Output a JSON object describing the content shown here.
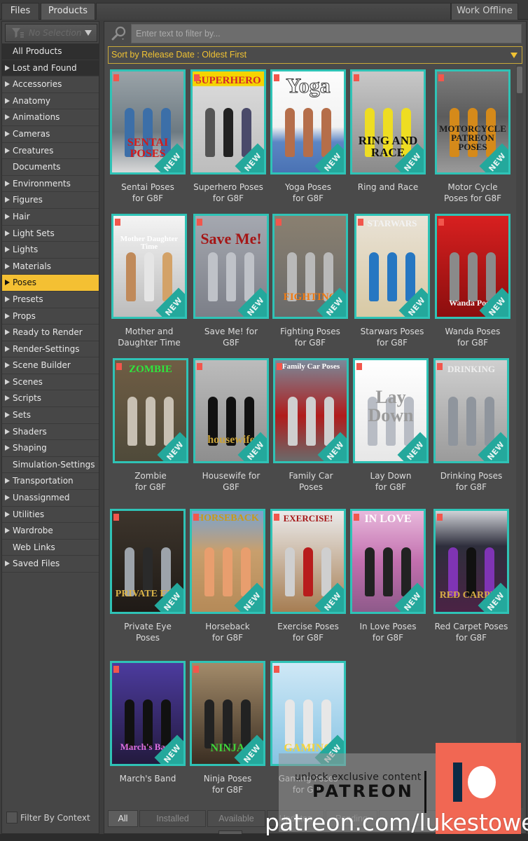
{
  "tabs": {
    "files": "Files",
    "products": "Products",
    "work_offline": "Work Offline"
  },
  "sidebar": {
    "filter_dropdown": {
      "value": "No Selection",
      "icon": "funnel-icon"
    },
    "categories": [
      {
        "label": "All Products",
        "expandable": false,
        "state": "header"
      },
      {
        "label": "Lost and Found",
        "expandable": true,
        "state": "dark"
      },
      {
        "label": "Accessories",
        "expandable": true
      },
      {
        "label": "Anatomy",
        "expandable": true
      },
      {
        "label": "Animations",
        "expandable": true
      },
      {
        "label": "Cameras",
        "expandable": true
      },
      {
        "label": "Creatures",
        "expandable": true
      },
      {
        "label": "Documents",
        "expandable": false
      },
      {
        "label": "Environments",
        "expandable": true
      },
      {
        "label": "Figures",
        "expandable": true
      },
      {
        "label": "Hair",
        "expandable": true
      },
      {
        "label": "Light Sets",
        "expandable": true
      },
      {
        "label": "Lights",
        "expandable": true
      },
      {
        "label": "Materials",
        "expandable": true
      },
      {
        "label": "Poses",
        "expandable": true,
        "state": "selected"
      },
      {
        "label": "Presets",
        "expandable": true
      },
      {
        "label": "Props",
        "expandable": true
      },
      {
        "label": "Ready to Render",
        "expandable": true
      },
      {
        "label": "Render-Settings",
        "expandable": true
      },
      {
        "label": "Scene Builder",
        "expandable": true
      },
      {
        "label": "Scenes",
        "expandable": true
      },
      {
        "label": "Scripts",
        "expandable": true
      },
      {
        "label": "Sets",
        "expandable": true
      },
      {
        "label": "Shaders",
        "expandable": true
      },
      {
        "label": "Shaping",
        "expandable": true
      },
      {
        "label": "Simulation-Settings",
        "expandable": false
      },
      {
        "label": "Transportation",
        "expandable": true
      },
      {
        "label": "Unassignmed",
        "expandable": true
      },
      {
        "label": "Utilities",
        "expandable": true
      },
      {
        "label": "Wardrobe",
        "expandable": true
      },
      {
        "label": "Web Links",
        "expandable": false
      },
      {
        "label": "Saved Files",
        "expandable": true
      }
    ],
    "filter_by_context": {
      "label": "Filter By Context",
      "checked": false
    }
  },
  "main": {
    "search": {
      "placeholder": "Enter text to filter by...",
      "value": ""
    },
    "sort": {
      "value": "Sort by Release Date : Oldest First"
    },
    "badge_text": "NEW",
    "colors": {
      "selected": "#f4c033",
      "accent_border": "#2fc3b6",
      "sort_text": "#f0c233",
      "new_badge": "#24a89c"
    },
    "products": [
      {
        "name": "Sentai Poses for G8F",
        "line1": "Sentai Poses",
        "line2": "for G8F",
        "cover_text": "SENTAI POSES"
      },
      {
        "name": "Superhero Poses for G8F",
        "line1": "Superhero Poses",
        "line2": "for G8F",
        "cover_text": "SUPERHERO"
      },
      {
        "name": "Yoga Poses for G8F",
        "line1": "Yoga Poses",
        "line2": "for G8F",
        "cover_text": "Yoga"
      },
      {
        "name": "Ring and Race",
        "line1": "Ring and Race",
        "line2": "",
        "cover_text": "RING AND RACE"
      },
      {
        "name": "Motor Cycle Poses for G8F",
        "line1": "Motor Cycle",
        "line2": "Poses for G8F",
        "cover_text": "MOTORCYCLE PATREON POSES"
      },
      {
        "name": "Mother and Daughter Time",
        "line1": "Mother and",
        "line2": "Daughter Time",
        "cover_text": "Mother Daughter Time"
      },
      {
        "name": "Save Me! for G8F",
        "line1": "Save Me! for",
        "line2": "G8F",
        "cover_text": "Save Me!"
      },
      {
        "name": "Fighting Poses for G8F",
        "line1": "Fighting Poses",
        "line2": "for G8F",
        "cover_text": "FIGHTING"
      },
      {
        "name": "Starwars Poses for G8F",
        "line1": "Starwars Poses",
        "line2": "for G8F",
        "cover_text": "STARWARS"
      },
      {
        "name": "Wanda Poses for G8F",
        "line1": "Wanda Poses",
        "line2": "for G8F",
        "cover_text": "Wanda Poses"
      },
      {
        "name": "Zombie for G8F",
        "line1": "Zombie",
        "line2": "for G8F",
        "cover_text": "ZOMBIE"
      },
      {
        "name": "Housewife for G8F",
        "line1": "Housewife for",
        "line2": "G8F",
        "cover_text": "housewife"
      },
      {
        "name": "Family Car Poses",
        "line1": "Family Car",
        "line2": "Poses",
        "cover_text": "Family Car Poses"
      },
      {
        "name": "Lay Down for G8F",
        "line1": "Lay Down",
        "line2": "for G8F",
        "cover_text": "Lay Down"
      },
      {
        "name": "Drinking Poses for G8F",
        "line1": "Drinking Poses",
        "line2": "for G8F",
        "cover_text": "DRINKING"
      },
      {
        "name": "Private Eye Poses",
        "line1": "Private Eye",
        "line2": "Poses",
        "cover_text": "PRIVATE EYE"
      },
      {
        "name": "Horseback for G8F",
        "line1": "Horseback",
        "line2": "for G8F",
        "cover_text": "HORSEBACK"
      },
      {
        "name": "Exercise Poses for G8F",
        "line1": "Exercise Poses",
        "line2": "for G8F",
        "cover_text": "EXERCISE!"
      },
      {
        "name": "In Love Poses for G8F",
        "line1": "In Love Poses",
        "line2": "for G8F",
        "cover_text": "IN LOVE"
      },
      {
        "name": "Red Carpet Poses for G8F",
        "line1": "Red Carpet Poses",
        "line2": "for G8F",
        "cover_text": "RED CARPET"
      },
      {
        "name": "March's Band",
        "line1": "March's Band",
        "line2": "",
        "cover_text": "March's Band"
      },
      {
        "name": "Ninja Poses for G8F",
        "line1": "Ninja Poses",
        "line2": "for G8F",
        "cover_text": "NINJA"
      },
      {
        "name": "Gaming Poses for G8F",
        "line1": "Gaming Poses",
        "line2": "for G8F",
        "cover_text": "GAMING"
      }
    ],
    "bottom_tabs": [
      "All",
      "Installed",
      "Available",
      "Updates",
      "Pending"
    ],
    "active_bottom_tab": "All"
  },
  "watermark": {
    "tagline": "unlock exclusive content",
    "brand": "PATREON",
    "url": "patreon.com/lukestowe"
  }
}
